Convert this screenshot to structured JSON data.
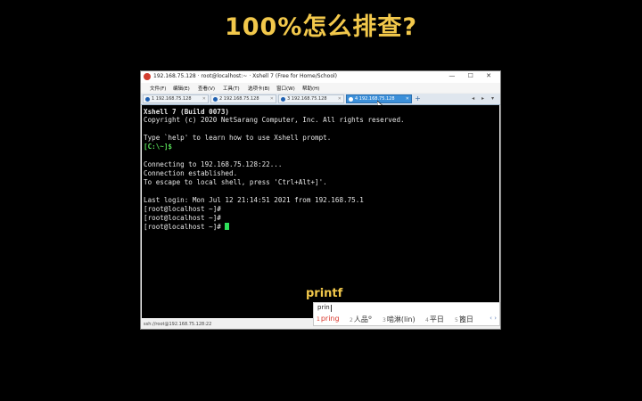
{
  "headline": "100%怎么排查?",
  "window": {
    "title": "192.168.75.128 · root@localhost:~ · Xshell 7 (Free for Home/School)",
    "controls": "— ☐ ✕",
    "menu": [
      "文件(F)",
      "编辑(E)",
      "查看(V)",
      "工具(T)",
      "选项卡(B)",
      "窗口(W)",
      "帮助(H)"
    ],
    "tabs": [
      {
        "label": "1 192.168.75.128",
        "active": false
      },
      {
        "label": "2 192.168.75.128",
        "active": false
      },
      {
        "label": "3 192.168.75.128",
        "active": false
      },
      {
        "label": "4 192.168.75.128",
        "active": true
      }
    ],
    "add_tab": "+",
    "tab_nav": "◂ ▸ ▾",
    "status": "ssh://root@192.168.75.128:22"
  },
  "terminal": {
    "lines": [
      "Xshell 7 (Build 0073)",
      "Copyright (c) 2020 NetSarang Computer, Inc. All rights reserved.",
      "",
      "Type `help' to learn how to use Xshell prompt.",
      "[C:\\~]$",
      "",
      "Connecting to 192.168.75.128:22...",
      "Connection established.",
      "To escape to local shell, press 'Ctrl+Alt+]'.",
      "",
      "Last login: Mon Jul 12 21:14:51 2021 from 192.168.75.1",
      "[root@localhost ~]#",
      "[root@localhost ~]#",
      "[root@localhost ~]#"
    ]
  },
  "overlay_word": "printf",
  "ime": {
    "input": "prin",
    "candidates": [
      {
        "num": "1",
        "text": "pring"
      },
      {
        "num": "2",
        "text": "人品",
        "sup": "⚙"
      },
      {
        "num": "3",
        "text": "啮淋(lin)"
      },
      {
        "num": "4",
        "text": "平日"
      },
      {
        "num": "5",
        "text": "篦日"
      }
    ],
    "nav": "‹ ›"
  },
  "colors": {
    "headline": "#f2c84b",
    "terminal_bg": "#000000",
    "prompt_green": "#5ae05a",
    "cursor_green": "#2ee05a",
    "active_tab": "#3b8fd9",
    "ime_selected": "#d9362b"
  }
}
